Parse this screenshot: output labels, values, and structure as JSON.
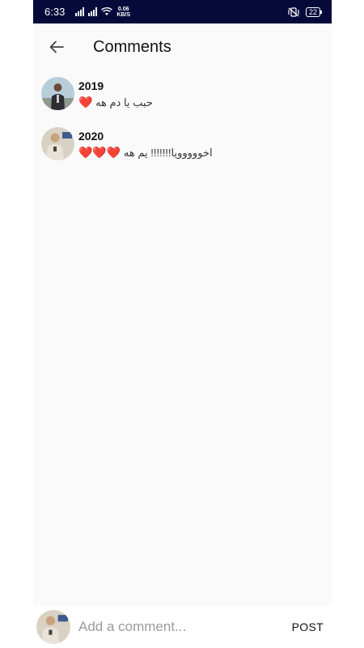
{
  "status_bar": {
    "time": "6:33",
    "net_speed_value": "0.06",
    "net_speed_unit": "KB/S",
    "battery": "22"
  },
  "app_bar": {
    "back_icon": "arrow-left-icon",
    "title": "Comments"
  },
  "comments": [
    {
      "user": "2019",
      "text": "حبب يا دم هه",
      "hearts": "❤️"
    },
    {
      "user": "2020",
      "text": "اخووووويا!!!!!!! يم هه",
      "hearts": "❤️❤️❤️"
    }
  ],
  "composer": {
    "placeholder": "Add a comment...",
    "post_label": "POST"
  },
  "colors": {
    "status_bar_bg": "#050a3a",
    "background": "#fafafa",
    "heart": "#e76f75"
  }
}
